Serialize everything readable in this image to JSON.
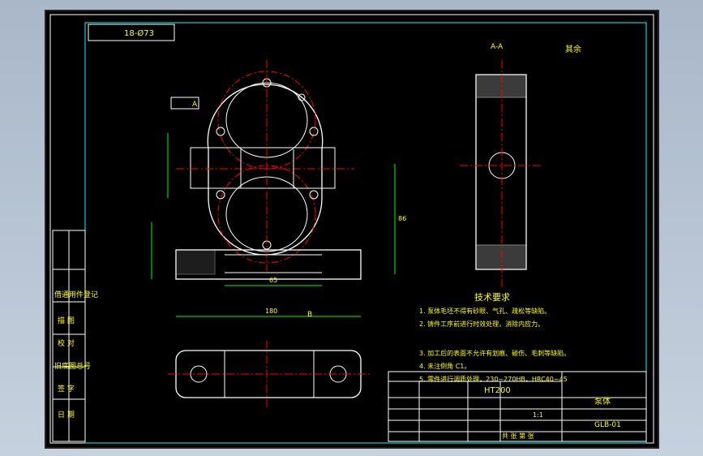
{
  "drawing": {
    "code_box": "18-Ø73",
    "section_label": "A-A",
    "surface_note": "其余",
    "tech_title": "技术要求",
    "tech_notes": [
      "1. 泵体毛坯不得有砂眼、气孔、疏松等缺陷。",
      "2. 铸件工序前进行时效处理，消除内应力。",
      "3. 加工后的表面不允许有划痕、碰伤、毛刺等缺陷。",
      "4. 未注倒角 C1。",
      "5. 零件进行调质处理，230~270HB，HRC40~45"
    ],
    "hardness": "HT200",
    "part_name": "泵体",
    "drawing_no": "GLB-01",
    "side_labels": [
      "借通用件登记",
      "描 图",
      "校 对",
      "旧底图总号",
      "签 字",
      "日 期"
    ],
    "datum_a": "A",
    "dim_bottom": "180",
    "dim_width": "65",
    "dim_height": "86",
    "view_b": "B",
    "scale": "1:1",
    "sheet": "共 张 第 张"
  },
  "colors": {
    "background": "#000000",
    "frame": "#00ffff",
    "outline": "#ffffff",
    "centerline": "#ff0000",
    "dimension": "#00ff00",
    "text": "#ffff00"
  }
}
